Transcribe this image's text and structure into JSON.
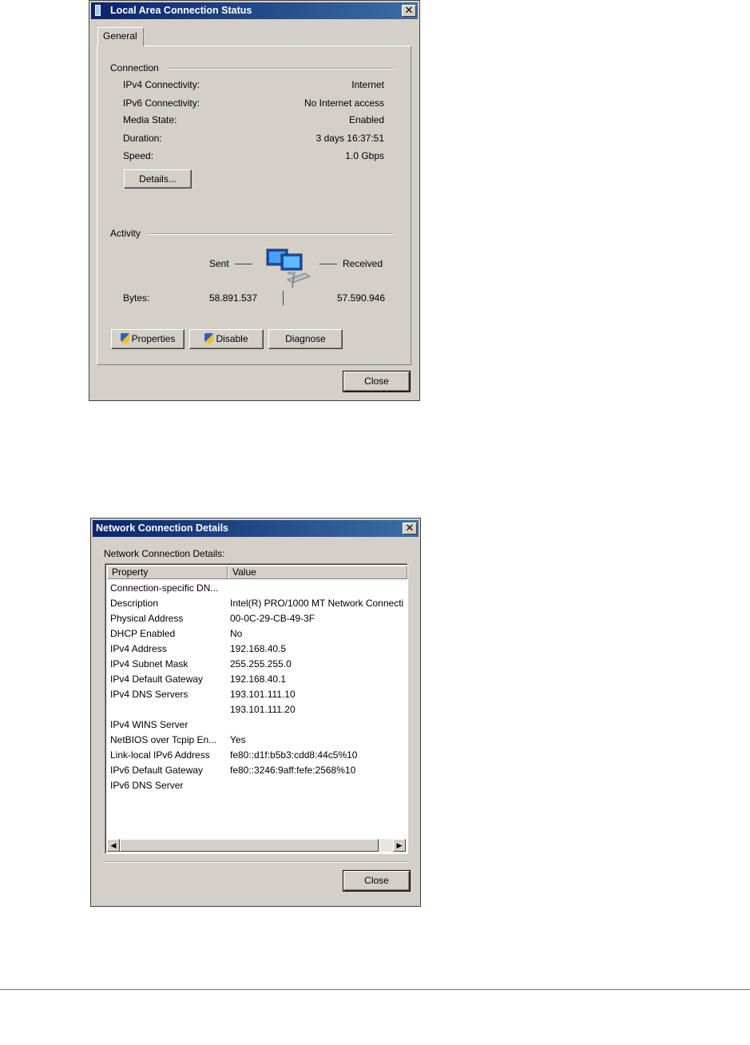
{
  "status_dialog": {
    "title": "Local Area Connection Status",
    "close_x": "✕",
    "tab": "General",
    "connection_group": "Connection",
    "rows": [
      {
        "label": "IPv4 Connectivity:",
        "value": "Internet"
      },
      {
        "label": "IPv6 Connectivity:",
        "value": "No Internet access"
      },
      {
        "label": "Media State:",
        "value": "Enabled"
      },
      {
        "label": "Duration:",
        "value": "3 days 16:37:51"
      },
      {
        "label": "Speed:",
        "value": "1.0 Gbps"
      }
    ],
    "details_button": "Details...",
    "activity_group": "Activity",
    "sent_label": "Sent",
    "received_label": "Received",
    "bytes_label": "Bytes:",
    "bytes_sent": "58.891.537",
    "bytes_received": "57.590.946",
    "properties_button": "Properties",
    "disable_button": "Disable",
    "diagnose_button": "Diagnose",
    "close_button": "Close"
  },
  "details_dialog": {
    "title": "Network Connection Details",
    "close_x": "✕",
    "caption": "Network Connection Details:",
    "col_property": "Property",
    "col_value": "Value",
    "rows": [
      {
        "property": "Connection-specific DN...",
        "value": ""
      },
      {
        "property": "Description",
        "value": "Intel(R) PRO/1000 MT Network Connecti"
      },
      {
        "property": "Physical Address",
        "value": "00-0C-29-CB-49-3F"
      },
      {
        "property": "DHCP Enabled",
        "value": "No"
      },
      {
        "property": "IPv4 Address",
        "value": "192.168.40.5"
      },
      {
        "property": "IPv4 Subnet Mask",
        "value": "255.255.255.0"
      },
      {
        "property": "IPv4 Default Gateway",
        "value": "192.168.40.1"
      },
      {
        "property": "IPv4 DNS Servers",
        "value": "193.101.111.10"
      },
      {
        "property": "",
        "value": "193.101.111.20"
      },
      {
        "property": "IPv4 WINS Server",
        "value": ""
      },
      {
        "property": "NetBIOS over Tcpip En...",
        "value": "Yes"
      },
      {
        "property": "Link-local IPv6 Address",
        "value": "fe80::d1f:b5b3:cdd8:44c5%10"
      },
      {
        "property": "IPv6 Default Gateway",
        "value": "fe80::3246:9aff:fefe:2568%10"
      },
      {
        "property": "IPv6 DNS Server",
        "value": ""
      }
    ],
    "scroll_left": "◀",
    "scroll_right": "▶",
    "close_button": "Close"
  }
}
